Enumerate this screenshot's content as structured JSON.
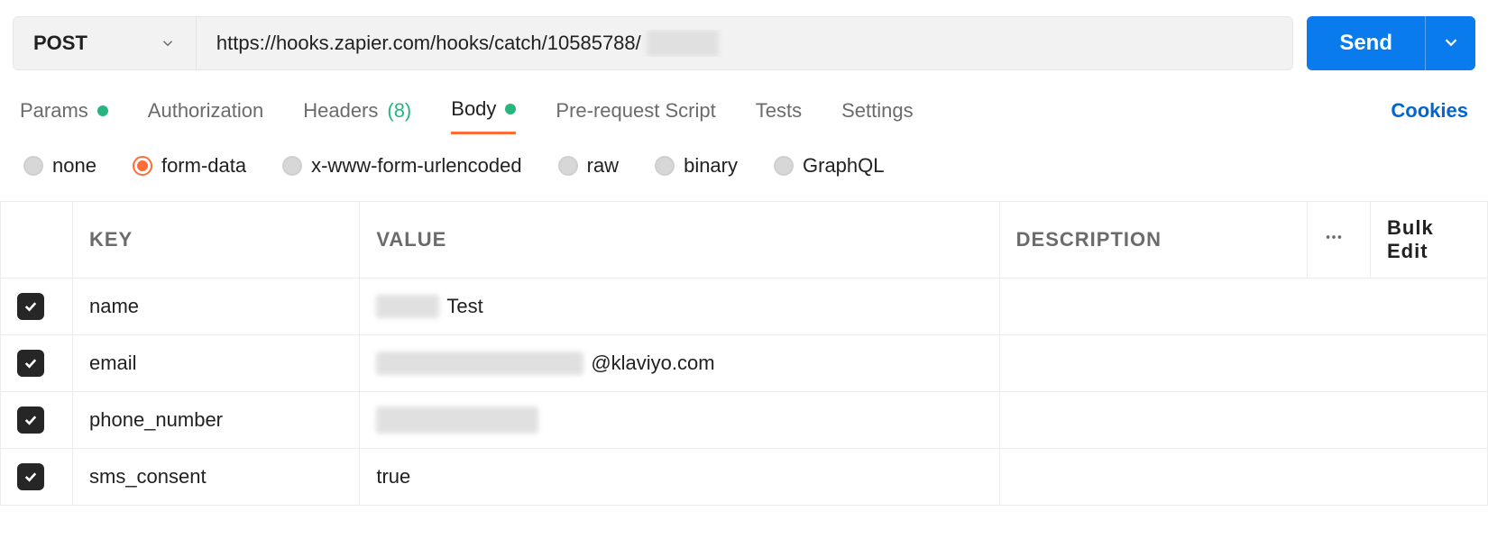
{
  "request": {
    "method": "POST",
    "url_prefix": "https://hooks.zapier.com/hooks/catch/10585788/",
    "send_label": "Send"
  },
  "tabs": {
    "params": "Params",
    "authorization": "Authorization",
    "headers": "Headers",
    "headers_count": "(8)",
    "body": "Body",
    "prerequest": "Pre-request Script",
    "tests": "Tests",
    "settings": "Settings",
    "cookies": "Cookies"
  },
  "body_types": {
    "none": "none",
    "form_data": "form-data",
    "urlencoded": "x-www-form-urlencoded",
    "raw": "raw",
    "binary": "binary",
    "graphql": "GraphQL"
  },
  "table": {
    "headers": {
      "key": "KEY",
      "value": "VALUE",
      "description": "DESCRIPTION",
      "bulk_edit": "Bulk Edit"
    },
    "rows": [
      {
        "key": "name",
        "value_suffix": "Test",
        "description": ""
      },
      {
        "key": "email",
        "value_suffix": "@klaviyo.com",
        "description": ""
      },
      {
        "key": "phone_number",
        "value_suffix": "",
        "description": ""
      },
      {
        "key": "sms_consent",
        "value_suffix": "true",
        "description": ""
      }
    ]
  }
}
